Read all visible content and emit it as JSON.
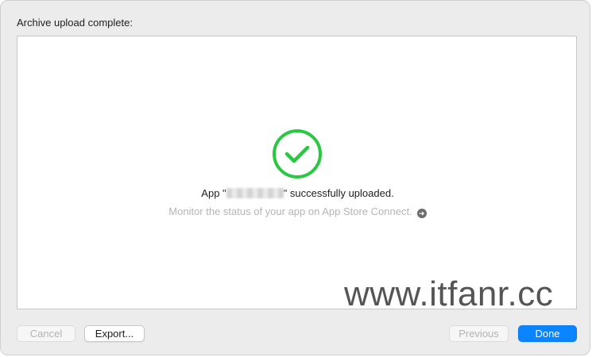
{
  "header": {
    "title": "Archive upload complete:"
  },
  "status": {
    "icon": "checkmark-circle-icon",
    "icon_color": "#28c840",
    "message_prefix": "App \"",
    "message_suffix": "\" successfully uploaded.",
    "monitor_text": "Monitor the status of your app on App Store Connect.",
    "monitor_icon": "arrow-right-circle-icon"
  },
  "watermark": {
    "text": "www.itfanr.cc"
  },
  "buttons": {
    "cancel": "Cancel",
    "export": "Export...",
    "previous": "Previous",
    "done": "Done"
  },
  "colors": {
    "accent": "#0a84ff",
    "success": "#28c840"
  }
}
